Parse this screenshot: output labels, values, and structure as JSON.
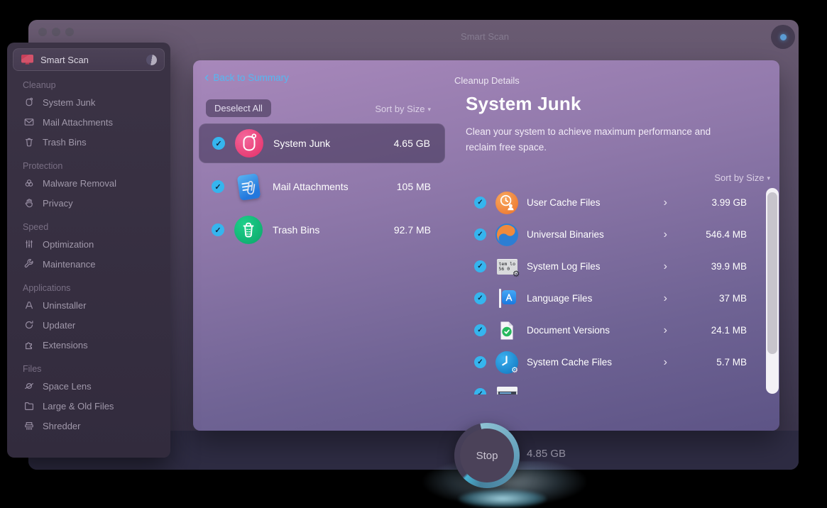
{
  "glyphs": {
    "caret": "▾",
    "back_chevron": "‹",
    "row_chevron": "›",
    "check": "✓"
  },
  "window": {
    "title": "Smart Scan"
  },
  "sidebar": {
    "selected": {
      "label": "Smart Scan",
      "icon": "smart-scan"
    },
    "sections": [
      {
        "title": "Cleanup",
        "items": [
          {
            "label": "System Junk",
            "icon": "system-junk"
          },
          {
            "label": "Mail Attachments",
            "icon": "mail"
          },
          {
            "label": "Trash Bins",
            "icon": "trash"
          }
        ]
      },
      {
        "title": "Protection",
        "items": [
          {
            "label": "Malware Removal",
            "icon": "biohazard"
          },
          {
            "label": "Privacy",
            "icon": "hand"
          }
        ]
      },
      {
        "title": "Speed",
        "items": [
          {
            "label": "Optimization",
            "icon": "sliders"
          },
          {
            "label": "Maintenance",
            "icon": "wrench"
          }
        ]
      },
      {
        "title": "Applications",
        "items": [
          {
            "label": "Uninstaller",
            "icon": "uninstaller"
          },
          {
            "label": "Updater",
            "icon": "updater"
          },
          {
            "label": "Extensions",
            "icon": "puzzle"
          }
        ]
      },
      {
        "title": "Files",
        "items": [
          {
            "label": "Space Lens",
            "icon": "planet"
          },
          {
            "label": "Large & Old Files",
            "icon": "folder"
          },
          {
            "label": "Shredder",
            "icon": "shredder"
          }
        ]
      }
    ]
  },
  "panel": {
    "back_label": "Back to Summary",
    "deselect_all": "Deselect All",
    "sort_label": "Sort by Size",
    "summary_rows": [
      {
        "label": "System Junk",
        "size": "4.65 GB",
        "icon": "system-junk-app",
        "selected": true,
        "checked": true
      },
      {
        "label": "Mail Attachments",
        "size": "105 MB",
        "icon": "mail-app",
        "selected": false,
        "checked": true
      },
      {
        "label": "Trash Bins",
        "size": "92.7 MB",
        "icon": "trash-app",
        "selected": false,
        "checked": true
      }
    ],
    "details": {
      "header": "Cleanup Details",
      "title": "System Junk",
      "description": "Clean your system to achieve maximum performance and reclaim free space.",
      "sort_label": "Sort by Size",
      "rows": [
        {
          "label": "User Cache Files",
          "size": "3.99 GB",
          "icon": "user-cache",
          "checked": true
        },
        {
          "label": "Universal Binaries",
          "size": "546.4 MB",
          "icon": "universal-binaries",
          "checked": true
        },
        {
          "label": "System Log Files",
          "size": "39.9 MB",
          "icon": "system-log",
          "checked": true
        },
        {
          "label": "Language Files",
          "size": "37 MB",
          "icon": "language",
          "checked": true
        },
        {
          "label": "Document Versions",
          "size": "24.1 MB",
          "icon": "doc-versions",
          "checked": true
        },
        {
          "label": "System Cache Files",
          "size": "5.7 MB",
          "icon": "system-cache",
          "checked": true
        },
        {
          "label": "",
          "size": "",
          "icon": "system-log-2",
          "checked": true,
          "partial": true
        }
      ]
    }
  },
  "footer": {
    "stop_label": "Stop",
    "found_size": "4.85 GB"
  },
  "colors": {
    "accent_blue": "#54b8f2",
    "check_blue": "#35b5ee",
    "progress_teal": "#46b2d4",
    "panel_top": "#a888bb",
    "panel_bottom": "#5d5486"
  }
}
